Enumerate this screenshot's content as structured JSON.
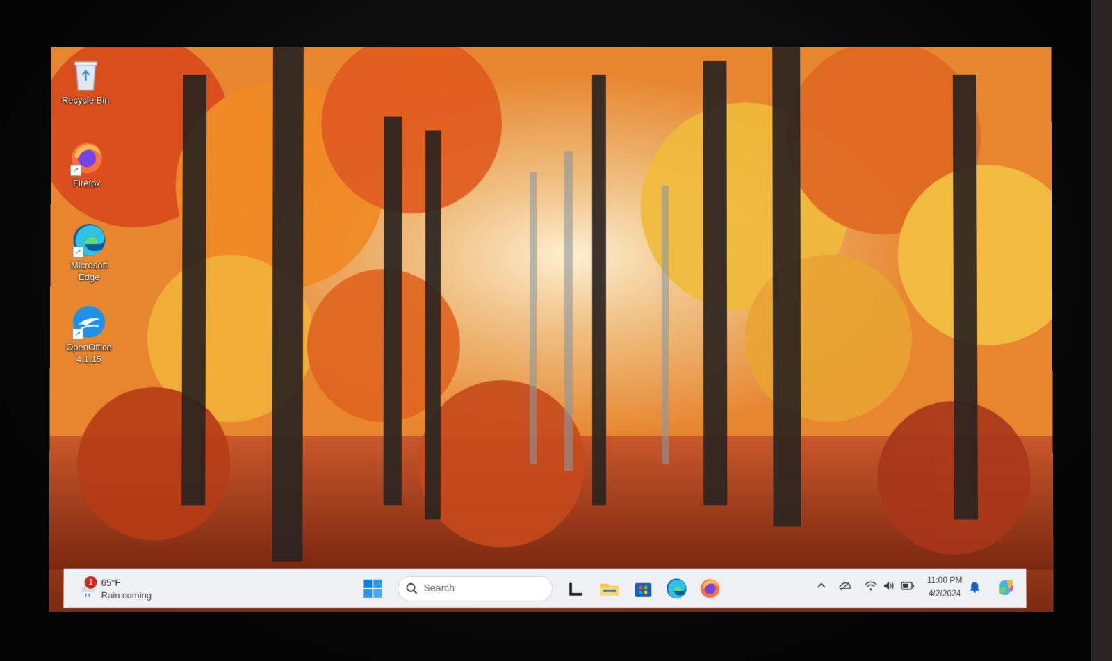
{
  "desktop": {
    "icons": [
      {
        "label": "Recycle Bin",
        "icon": "recycle-bin-icon"
      },
      {
        "label": "Firefox",
        "icon": "firefox-icon"
      },
      {
        "label": "Microsoft Edge",
        "icon": "edge-icon"
      },
      {
        "label": "OpenOffice 4.1.15",
        "icon": "openoffice-icon"
      }
    ]
  },
  "taskbar": {
    "weather": {
      "badge": "1",
      "temperature": "65°F",
      "condition": "Rain coming"
    },
    "search_placeholder": "Search",
    "pinned_apps": [
      "terminal-icon",
      "file-explorer-icon",
      "microsoft-store-icon",
      "edge-icon",
      "firefox-icon"
    ],
    "clock": {
      "time": "11:00 PM",
      "date": "4/2/2024"
    }
  },
  "colors": {
    "taskbar_bg": "#eef0f4",
    "accent": "#0078d4",
    "badge": "#c42b1c"
  }
}
